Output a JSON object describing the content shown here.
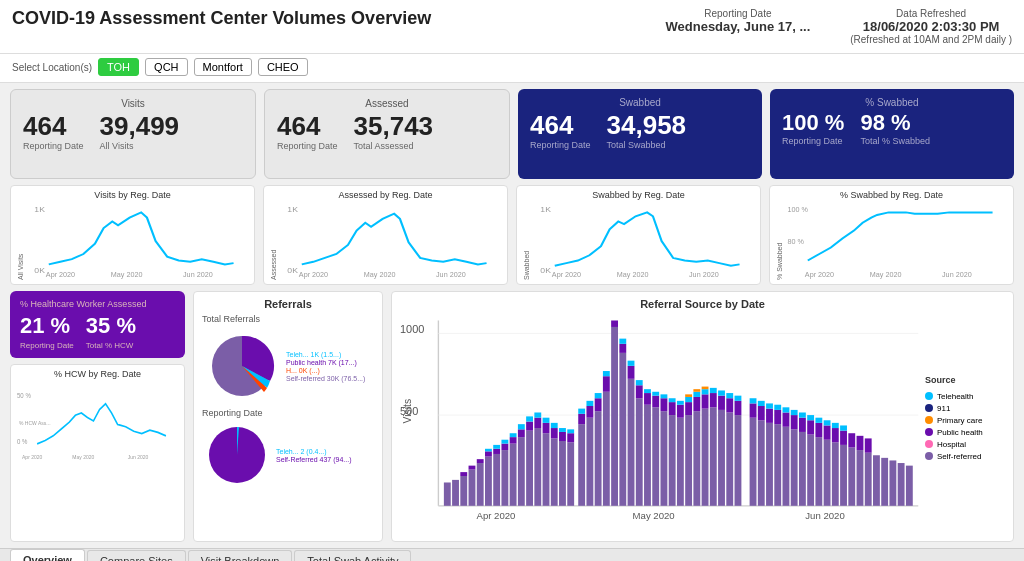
{
  "header": {
    "title": "COVID-19 Assessment Center Volumes Overview",
    "reporting_date_label": "Reporting Date",
    "reporting_date": "Wednesday, June 17, ...",
    "data_refreshed_label": "Data Refreshed",
    "data_refreshed": "18/06/2020 2:03:30 PM",
    "refresh_note": "(Refreshed at 10AM and 2PM daily )"
  },
  "location": {
    "label": "Select Location(s)",
    "buttons": [
      "TOH",
      "QCH",
      "Montfort",
      "CHEO"
    ],
    "active": "TOH"
  },
  "stats": {
    "visits": {
      "title": "Visits",
      "reporting_value": "464",
      "reporting_label": "Reporting Date",
      "all_value": "39,499",
      "all_label": "All Visits"
    },
    "assessed": {
      "title": "Assessed",
      "reporting_value": "464",
      "reporting_label": "Reporting Date",
      "total_value": "35,743",
      "total_label": "Total Assessed"
    },
    "swabbed": {
      "title": "Swabbed",
      "reporting_value": "464",
      "reporting_label": "Reporting Date",
      "total_value": "34,958",
      "total_label": "Total Swabbed"
    },
    "pct_swabbed": {
      "title": "% Swabbed",
      "reporting_value": "100 %",
      "reporting_label": "Reporting Date",
      "total_value": "98 %",
      "total_label": "Total % Swabbed"
    }
  },
  "chart_titles": {
    "visits_by_date": "Visits by Reg. Date",
    "assessed_by_date": "Assessed by Reg. Date",
    "swabbed_by_date": "Swabbed by Reg. Date",
    "pct_swabbed_by_date": "% Swabbed by Reg. Date"
  },
  "hcw": {
    "title": "% Healthcare Worker Assessed",
    "reporting_value": "21 %",
    "reporting_label": "Reporting Date",
    "total_value": "35 %",
    "total_label": "Total % HCW",
    "chart_title": "% HCW by Reg. Date",
    "y_label": "% HCW Ass..."
  },
  "referrals": {
    "title": "Referrals",
    "total_title": "Total Referrals",
    "reporting_title": "Reporting Date",
    "pie1_legend": [
      {
        "label": "Teleh... 1K (1.5...)",
        "color": "#00bfff"
      },
      {
        "label": "Public health 7K (17...)",
        "color": "#6a0dad"
      },
      {
        "label": "H... 0K (...)",
        "color": "#ff4500"
      },
      {
        "label": "Self-referred 30K (76.5...)",
        "color": "#7b5ea7"
      }
    ],
    "pie2_legend": [
      {
        "label": "Teleh... 2 (0.4...)",
        "color": "#00bfff"
      },
      {
        "label": "Self-Referred 437 (94...)",
        "color": "#6a0dad"
      }
    ]
  },
  "referral_source": {
    "title": "Referral Source by Date",
    "y_label": "Visits",
    "x_labels": [
      "Apr 2020",
      "May 2020",
      "Jun 2020"
    ],
    "y_ticks": [
      "1000",
      "500",
      ""
    ],
    "legend": [
      {
        "label": "Telehealth",
        "color": "#00bfff"
      },
      {
        "label": "911",
        "color": "#1a237e"
      },
      {
        "label": "Primary care",
        "color": "#ff8c00"
      },
      {
        "label": "Public health",
        "color": "#6a0dad"
      },
      {
        "label": "Hospital",
        "color": "#ff69b4"
      },
      {
        "label": "Self-referred",
        "color": "#7b5ea7"
      }
    ]
  },
  "tabs": [
    {
      "label": "Overview",
      "active": true
    },
    {
      "label": "Compare Sites",
      "active": false
    },
    {
      "label": "Visit Breakdown",
      "active": false
    },
    {
      "label": "Total Swab Activity",
      "active": false
    }
  ]
}
